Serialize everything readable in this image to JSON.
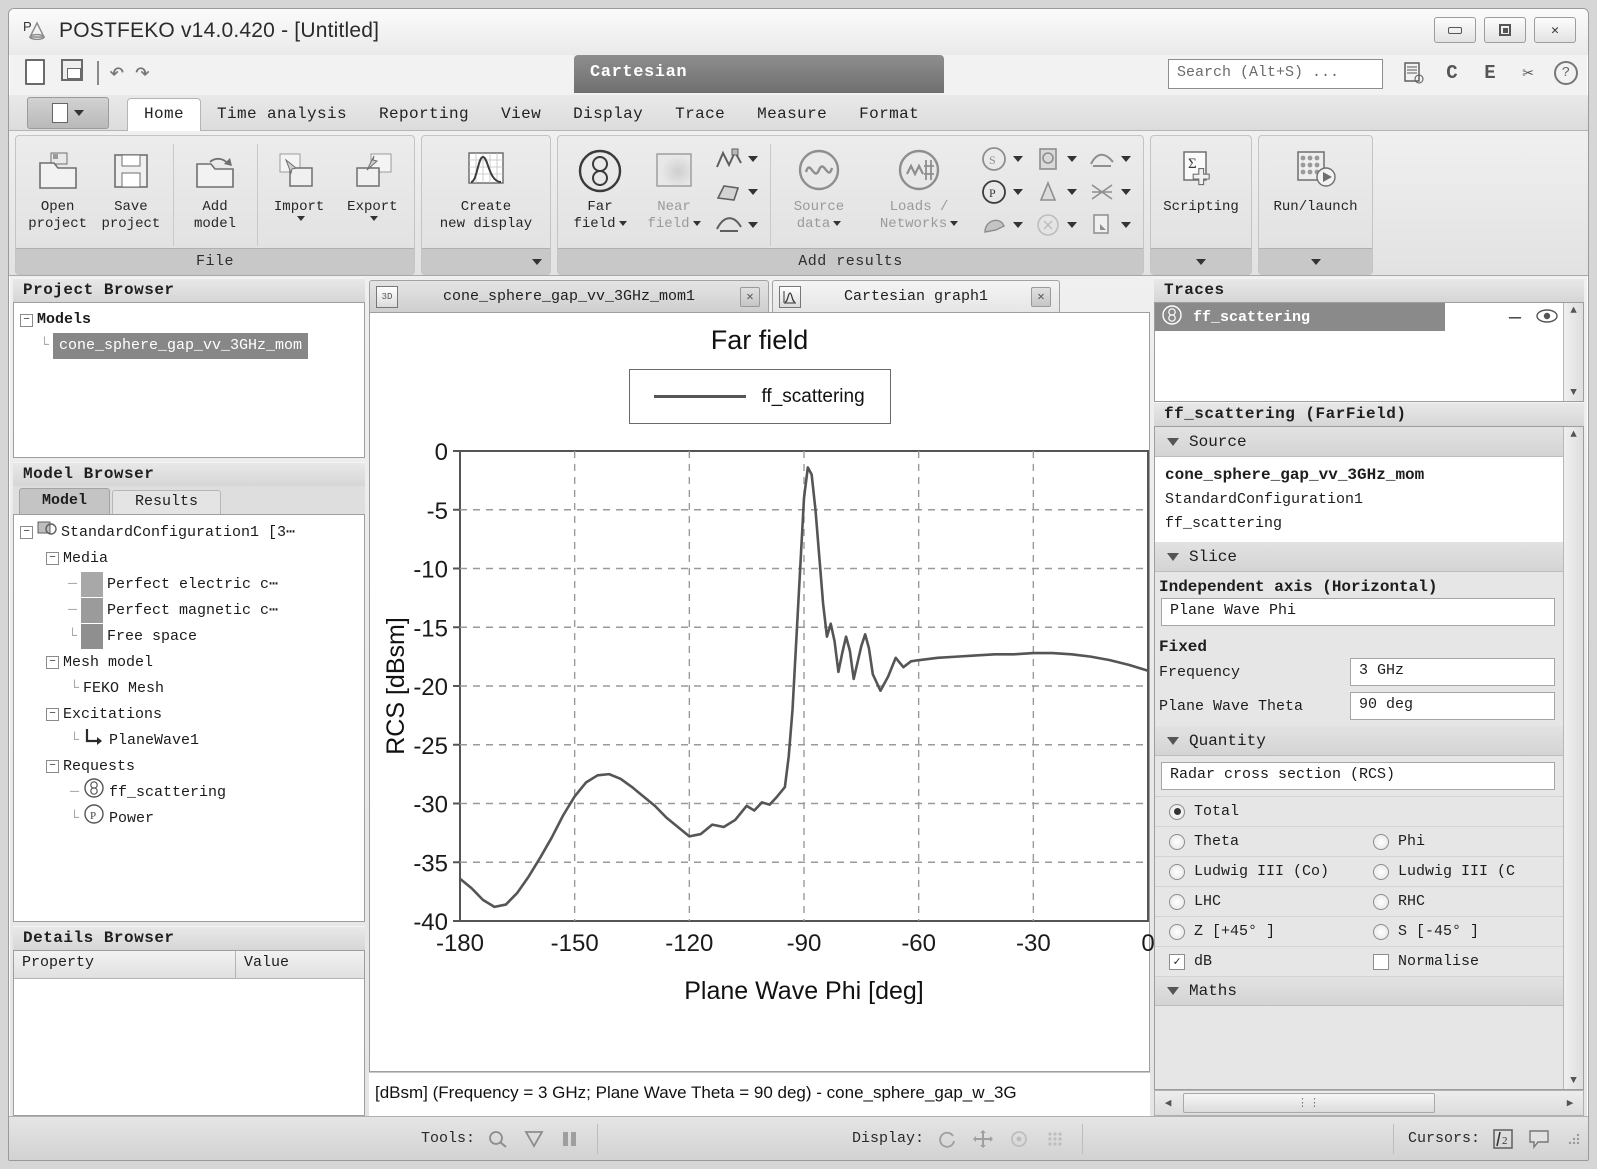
{
  "window": {
    "title": "POSTFEKO v14.0.420 - [Untitled]",
    "logo_icon": "postfeko-logo-icon",
    "minimize_label": "minimize",
    "maximize_label": "maximize",
    "close_label": "✕"
  },
  "quick_access": {
    "new_icon": "new-document-icon",
    "save_icon": "save-icon",
    "undo_icon": "↶",
    "redo_icon": "↷",
    "context_tab": "Cartesian"
  },
  "search": {
    "placeholder": "Search (Alt+S) ...",
    "value": ""
  },
  "header_icons": [
    {
      "name": "notes-icon",
      "glyph": "☷"
    },
    {
      "name": "cadfeko-icon",
      "glyph": "C"
    },
    {
      "name": "editfeko-icon",
      "glyph": "E"
    },
    {
      "name": "feko-kernel-icon",
      "glyph": "✂"
    },
    {
      "name": "help-icon",
      "glyph": "?"
    }
  ],
  "app_menu": {
    "name": "application-menu",
    "label": ""
  },
  "ribbon_tabs": [
    {
      "label": "Home",
      "active": true
    },
    {
      "label": "Time analysis",
      "active": false
    },
    {
      "label": "Reporting",
      "active": false
    },
    {
      "label": "View",
      "active": false
    },
    {
      "label": "Display",
      "active": false
    },
    {
      "label": "Trace",
      "active": false
    },
    {
      "label": "Measure",
      "active": false
    },
    {
      "label": "Format",
      "active": false
    }
  ],
  "ribbon": {
    "groups": [
      {
        "title": "File",
        "has_dialog_launcher": true,
        "buttons": [
          {
            "name": "open-project-button",
            "line1": "Open",
            "line2": "project",
            "icon": "open-folder-icon",
            "dim": false,
            "caret": false
          },
          {
            "name": "save-project-button",
            "line1": "Save",
            "line2": "project",
            "icon": "floppy-disk-icon",
            "dim": false,
            "caret": false
          },
          {
            "name": "add-model-button",
            "line1": "Add",
            "line2": "model",
            "icon": "add-model-icon",
            "dim": false,
            "caret": false
          },
          {
            "name": "import-button",
            "line1": "Import",
            "line2": "",
            "icon": "import-icon",
            "dim": false,
            "caret": true
          },
          {
            "name": "export-button",
            "line1": "Export",
            "line2": "",
            "icon": "export-icon",
            "dim": false,
            "caret": true
          }
        ]
      },
      {
        "title": "",
        "has_dialog_launcher": true,
        "buttons": [
          {
            "name": "create-new-display-button",
            "line1": "Create",
            "line2": "new display",
            "icon": "graph-icon",
            "dim": false,
            "caret": false
          }
        ]
      },
      {
        "title": "Add results",
        "has_dialog_launcher": false,
        "buttons": [
          {
            "name": "far-field-button",
            "line1": "Far",
            "line2": "field",
            "icon": "far-field-icon",
            "dim": false,
            "caret": true
          },
          {
            "name": "near-field-button",
            "line1": "Near",
            "line2": "field",
            "icon": "near-field-icon",
            "dim": true,
            "caret": true
          },
          {
            "name": "source-data-button",
            "line1": "Source",
            "line2": "data",
            "icon": "source-data-icon",
            "dim": true,
            "caret": true
          },
          {
            "name": "loads-networks-button",
            "line1": "Loads /",
            "line2": "Networks",
            "icon": "loads-networks-icon",
            "dim": true,
            "caret": true
          }
        ],
        "small_buttons": [
          {
            "name": "currents-icon",
            "glyph": "↯"
          },
          {
            "name": "surface-graph-icon",
            "glyph": "◧"
          },
          {
            "name": "error-estimate-icon",
            "glyph": "⤳"
          },
          {
            "name": "s-parameter-icon",
            "glyph": "S"
          },
          {
            "name": "power-icon",
            "glyph": "P"
          },
          {
            "name": "receiving-antenna-icon",
            "glyph": "◔"
          },
          {
            "name": "sar-icon",
            "glyph": "▣"
          },
          {
            "name": "transmission-line-icon",
            "glyph": "△"
          },
          {
            "name": "cable-icon",
            "glyph": "⊗"
          },
          {
            "name": "iso-surface-icon",
            "glyph": "⤳"
          },
          {
            "name": "mesh-info-icon",
            "glyph": "⨉"
          },
          {
            "name": "custom-data-icon",
            "glyph": "⎘"
          }
        ]
      },
      {
        "title": "",
        "has_dialog_launcher": true,
        "buttons": [
          {
            "name": "scripting-button",
            "line1": "Scripting",
            "line2": "",
            "icon": "scripting-icon",
            "dim": false,
            "caret": false
          }
        ]
      },
      {
        "title": "",
        "has_dialog_launcher": true,
        "buttons": [
          {
            "name": "run-launch-button",
            "line1": "Run/launch",
            "line2": "",
            "icon": "abacus-run-icon",
            "dim": false,
            "caret": false
          }
        ]
      }
    ]
  },
  "project_browser": {
    "title": "Project Browser",
    "root": "Models",
    "selected_item": "cone_sphere_gap_vv_3GHz_mom"
  },
  "model_browser": {
    "title": "Model Browser",
    "tabs": [
      {
        "label": "Model",
        "active": true
      },
      {
        "label": "Results",
        "active": false
      }
    ],
    "tree": [
      {
        "label": "StandardConfiguration1 [3⋯",
        "depth": 0,
        "expander": "-",
        "icon": "configuration-icon"
      },
      {
        "label": "Media",
        "depth": 1,
        "expander": "-",
        "icon": ""
      },
      {
        "label": "Perfect electric c⋯",
        "depth": 2,
        "expander": "",
        "icon": "media-swatch-icon"
      },
      {
        "label": "Perfect magnetic c⋯",
        "depth": 2,
        "expander": "",
        "icon": "media-swatch-icon"
      },
      {
        "label": "Free space",
        "depth": 2,
        "expander": "",
        "icon": "media-swatch-icon"
      },
      {
        "label": "Mesh model",
        "depth": 1,
        "expander": "-",
        "icon": ""
      },
      {
        "label": "FEKO Mesh",
        "depth": 2,
        "expander": "",
        "icon": ""
      },
      {
        "label": "Excitations",
        "depth": 1,
        "expander": "-",
        "icon": ""
      },
      {
        "label": "PlaneWave1",
        "depth": 2,
        "expander": "",
        "icon": "plane-wave-icon"
      },
      {
        "label": "Requests",
        "depth": 1,
        "expander": "-",
        "icon": ""
      },
      {
        "label": "ff_scattering",
        "depth": 2,
        "expander": "",
        "icon": "far-field-request-icon"
      },
      {
        "label": "Power",
        "depth": 2,
        "expander": "",
        "icon": "power-request-icon"
      }
    ]
  },
  "details_browser": {
    "title": "Details Browser",
    "columns": [
      "Property",
      "Value"
    ],
    "rows": []
  },
  "display_tabs": [
    {
      "label": "cone_sphere_gap_vv_3GHz_mom1",
      "icon": "3d-view-icon",
      "active": false,
      "close": "✕"
    },
    {
      "label": "Cartesian graph1",
      "icon": "cartesian-graph-icon",
      "active": true,
      "close": "✕"
    }
  ],
  "chart_data": {
    "type": "line",
    "title": "Far field",
    "xlabel": "Plane Wave Phi [deg]",
    "ylabel": "RCS [dBsm]",
    "xlim": [
      -180,
      0
    ],
    "ylim": [
      -40,
      0
    ],
    "xticks": [
      -180,
      -150,
      -120,
      -90,
      -60,
      -30,
      0
    ],
    "yticks": [
      0,
      -5,
      -10,
      -15,
      -20,
      -25,
      -30,
      -35,
      -40
    ],
    "grid": true,
    "legend_position": "top-center",
    "series": [
      {
        "name": "ff_scattering",
        "color": "#555555",
        "x": [
          -180,
          -177,
          -174,
          -171,
          -168,
          -165,
          -162,
          -159,
          -156,
          -153,
          -150,
          -147,
          -144,
          -141,
          -138,
          -135,
          -132,
          -129,
          -126,
          -123,
          -120,
          -117,
          -114,
          -111,
          -108,
          -105,
          -103,
          -101,
          -99,
          -97,
          -95,
          -94,
          -93,
          -92,
          -91,
          -90,
          -89,
          -88,
          -87,
          -86,
          -85,
          -84,
          -83,
          -82,
          -81,
          -80,
          -79,
          -78,
          -77,
          -76,
          -75,
          -74,
          -73,
          -72,
          -70,
          -68,
          -66,
          -64,
          -62,
          -60,
          -55,
          -50,
          -45,
          -40,
          -35,
          -30,
          -25,
          -20,
          -15,
          -10,
          -5,
          0
        ],
        "y": [
          -36.4,
          -37.2,
          -38.2,
          -38.8,
          -38.6,
          -37.6,
          -36.2,
          -34.6,
          -32.9,
          -31.0,
          -29.4,
          -28.2,
          -27.6,
          -27.5,
          -27.9,
          -28.6,
          -29.4,
          -30.2,
          -31.2,
          -32.0,
          -32.8,
          -32.6,
          -31.8,
          -32.0,
          -31.4,
          -30.2,
          -30.6,
          -29.9,
          -30.1,
          -29.4,
          -28.6,
          -26.0,
          -22.0,
          -16.0,
          -10.0,
          -4.0,
          -1.4,
          -2.0,
          -5.0,
          -9.0,
          -13.0,
          -15.8,
          -14.7,
          -16.2,
          -18.8,
          -17.2,
          -15.8,
          -17.0,
          -19.4,
          -18.0,
          -16.6,
          -15.6,
          -16.8,
          -19.0,
          -20.4,
          -19.2,
          -17.6,
          -18.4,
          -17.9,
          -17.8,
          -17.6,
          -17.5,
          -17.4,
          -17.3,
          -17.3,
          -17.2,
          -17.2,
          -17.3,
          -17.5,
          -17.8,
          -18.2,
          -18.7
        ]
      }
    ]
  },
  "chart_status": "[dBsm] (Frequency = 3 GHz; Plane Wave Theta = 90 deg) - cone_sphere_gap_w_3G",
  "traces_panel": {
    "title": "Traces",
    "items": [
      {
        "label": "ff_scattering",
        "icon": "far-field-trace-icon",
        "line_style": "—",
        "visibility_icon": "eye-icon",
        "selected": true
      }
    ]
  },
  "properties_panel": {
    "header": "ff_scattering (FarField)",
    "sections": {
      "source": {
        "label": "Source",
        "model": "cone_sphere_gap_vv_3GHz_mom",
        "configuration": "StandardConfiguration1",
        "request": "ff_scattering"
      },
      "slice": {
        "label": "Slice",
        "independent_axis_label": "Independent axis (Horizontal)",
        "independent_axis_value": "Plane Wave Phi",
        "fixed_label": "Fixed",
        "fields": [
          {
            "label": "Frequency",
            "value": "3 GHz"
          },
          {
            "label": "Plane Wave Theta",
            "value": "90 deg"
          }
        ]
      },
      "quantity": {
        "label": "Quantity",
        "selected_quantity": "Radar cross section (RCS)",
        "radios": [
          [
            {
              "label": "Total",
              "selected": true
            }
          ],
          [
            {
              "label": "Theta",
              "selected": false
            },
            {
              "label": "Phi",
              "selected": false
            }
          ],
          [
            {
              "label": "Ludwig III (Co)",
              "selected": false
            },
            {
              "label": "Ludwig III (C",
              "selected": false
            }
          ],
          [
            {
              "label": "LHC",
              "selected": false
            },
            {
              "label": "RHC",
              "selected": false
            }
          ],
          [
            {
              "label": "Z [+45° ]",
              "selected": false
            },
            {
              "label": "S [-45° ]",
              "selected": false
            }
          ]
        ],
        "checkboxes": [
          {
            "label": "dB",
            "checked": true
          },
          {
            "label": "Normalise",
            "checked": false
          }
        ]
      },
      "maths": {
        "label": "Maths"
      }
    }
  },
  "status_bar": {
    "tools_label": "Tools:",
    "tools_icons": [
      {
        "name": "zoom-tool-icon",
        "glyph": "⌕"
      },
      {
        "name": "select-tool-icon",
        "glyph": "▽"
      },
      {
        "name": "measure-tool-icon",
        "glyph": "⚖"
      }
    ],
    "display_label": "Display:",
    "display_icons": [
      {
        "name": "rotate-icon",
        "glyph": "↻"
      },
      {
        "name": "pan-icon",
        "glyph": "✥"
      },
      {
        "name": "zoom-display-icon",
        "glyph": "⊙"
      },
      {
        "name": "grid-display-icon",
        "glyph": "∷"
      }
    ],
    "cursors_label": "Cursors:",
    "cursors_icons": [
      {
        "name": "cursor-add-icon",
        "glyph": "⌶"
      },
      {
        "name": "cursor-annotation-icon",
        "glyph": "⬜"
      }
    ]
  }
}
